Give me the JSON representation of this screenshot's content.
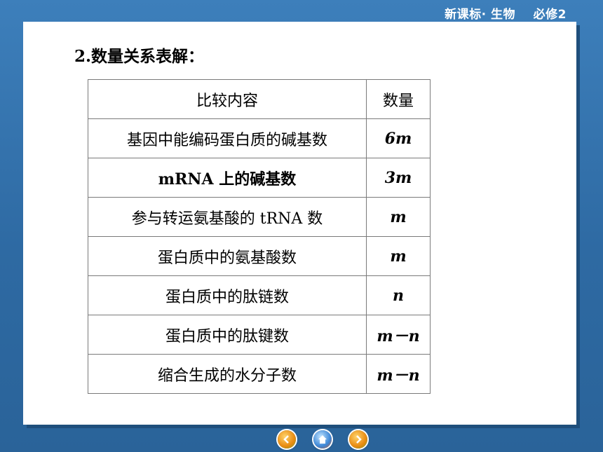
{
  "header": {
    "brand": "新课标· 生物    必修2"
  },
  "slide": {
    "heading": "2.数量关系表解：",
    "table": {
      "columns": [
        "比较内容",
        "数量"
      ],
      "rows": [
        {
          "item": "基因中能编码蛋白质的碱基数",
          "qty": "6m"
        },
        {
          "item": "mRNA 上的碱基数",
          "qty": "3m"
        },
        {
          "item": "参与转运氨基酸的 tRNA 数",
          "qty": "m"
        },
        {
          "item": "蛋白质中的氨基酸数",
          "qty": "m"
        },
        {
          "item": "蛋白质中的肽链数",
          "qty": "n"
        },
        {
          "item": "蛋白质中的肽键数",
          "qty": "m－n"
        },
        {
          "item": "缩合生成的水分子数",
          "qty": "m－n"
        }
      ]
    }
  },
  "nav": {
    "prev_icon": "back-arrow-icon",
    "home_icon": "home-icon",
    "next_icon": "forward-arrow-icon"
  }
}
